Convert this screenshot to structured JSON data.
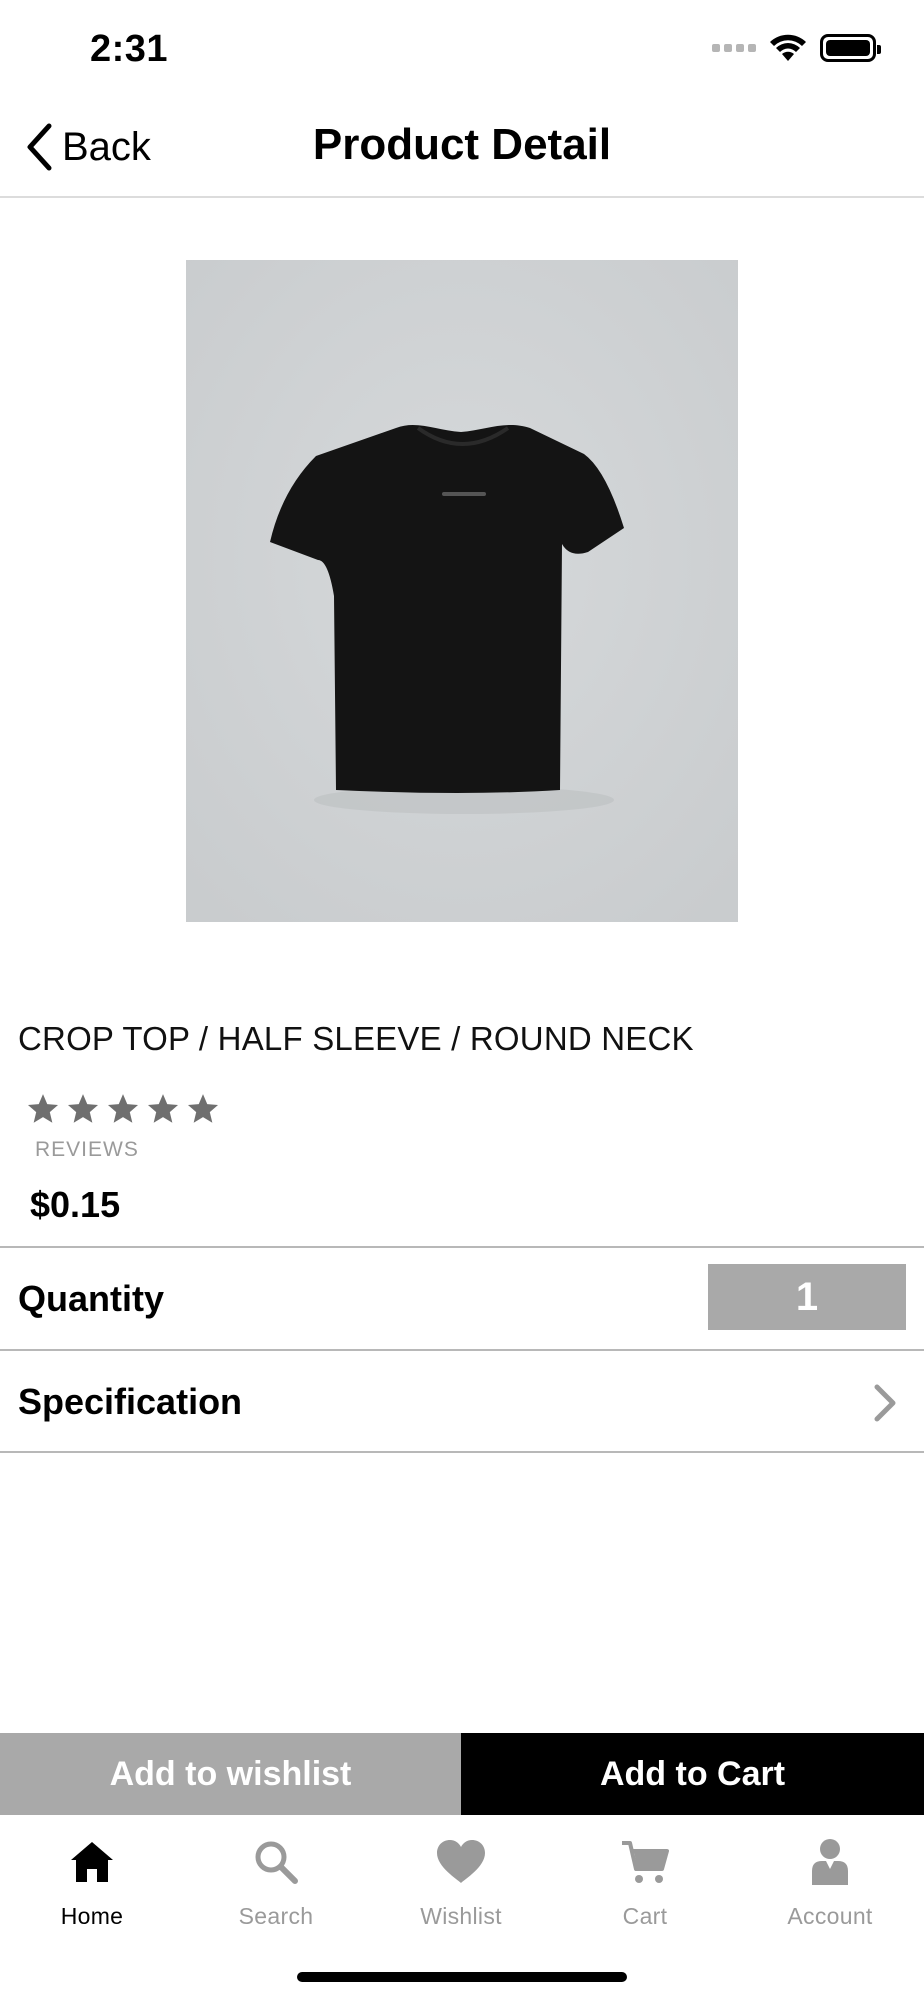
{
  "status_bar": {
    "time": "2:31"
  },
  "nav": {
    "back_label": "Back",
    "title": "Product Detail"
  },
  "product": {
    "title": "CROP TOP / HALF SLEEVE / ROUND NECK",
    "rating": 5,
    "rating_max": 5,
    "reviews_label": "REVIEWS",
    "price": "$0.15"
  },
  "quantity": {
    "label": "Quantity",
    "value": "1"
  },
  "specification": {
    "label": "Specification"
  },
  "actions": {
    "wishlist_label": "Add to wishlist",
    "cart_label": "Add to Cart"
  },
  "tabs": [
    {
      "label": "Home",
      "icon": "home-icon",
      "active": true
    },
    {
      "label": "Search",
      "icon": "search-icon",
      "active": false
    },
    {
      "label": "Wishlist",
      "icon": "heart-icon",
      "active": false
    },
    {
      "label": "Cart",
      "icon": "cart-icon",
      "active": false
    },
    {
      "label": "Account",
      "icon": "user-icon",
      "active": false
    }
  ],
  "colors": {
    "accent": "#000000",
    "muted": "#a9a9a9",
    "star": "#6f6f6f"
  }
}
